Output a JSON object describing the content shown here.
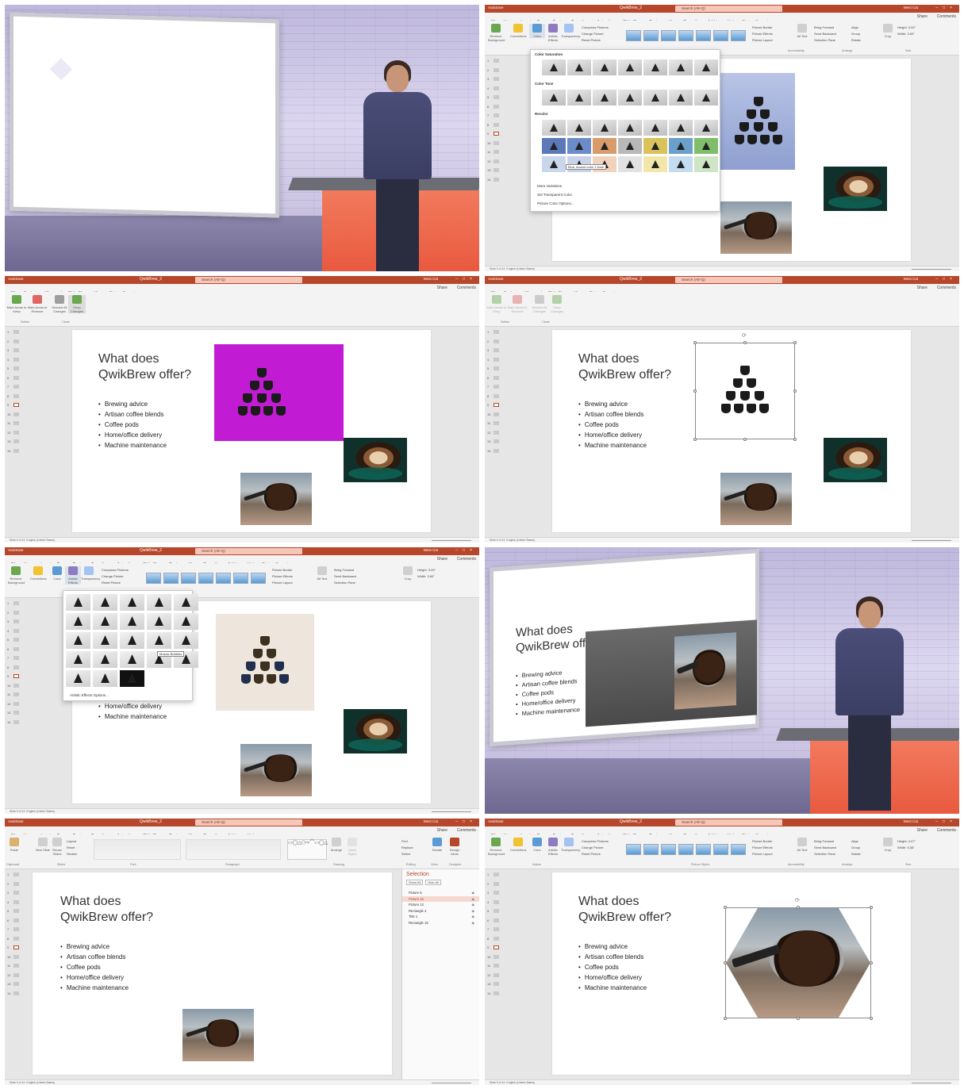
{
  "window": {
    "autosave": "AutoSave",
    "doc_title": "QwikBrew_2",
    "search_placeholder": "Search (Alt+Q)",
    "user_name": "West Cat",
    "share": "Share",
    "comments": "Comments"
  },
  "tabs_full": [
    "File",
    "Home",
    "Insert",
    "Draw",
    "Design",
    "Transitions",
    "Animations",
    "Slide Show",
    "Review",
    "View",
    "Recording",
    "Add-ins",
    "Help",
    "Picture Format"
  ],
  "tabs_bg_removal": [
    "File",
    "Background Removal",
    "Slide Show",
    "View",
    "Picture Format"
  ],
  "tabs_home": [
    "File",
    "Home",
    "Insert",
    "Draw",
    "Design",
    "Transitions",
    "Animations",
    "Slide Show",
    "Review",
    "View",
    "Recording",
    "Add-ins",
    "Help"
  ],
  "ribbon_picture_format": {
    "remove_background": "Remove Background",
    "corrections": "Corrections",
    "color": "Color",
    "artistic_effects": "Artistic Effects",
    "transparency": "Transparency",
    "compress": "Compress Pictures",
    "change": "Change Picture",
    "reset": "Reset Picture",
    "border": "Picture Border",
    "effects": "Picture Effects",
    "layout": "Picture Layout",
    "alt_text": "Alt Text",
    "bring_forward": "Bring Forward",
    "send_backward": "Send Backward",
    "selection_pane": "Selection Pane",
    "align": "Align",
    "group": "Group",
    "rotate": "Rotate",
    "crop": "Crop",
    "height_label": "Height:",
    "width_label": "Width:",
    "groups": [
      "Adjust",
      "Picture Styles",
      "Accessibility",
      "Arrange",
      "Size"
    ]
  },
  "ribbon_bg_removal": {
    "mark_keep": "Mark Areas to Keep",
    "mark_remove": "Mark Areas to Remove",
    "discard": "Discard All Changes",
    "keep": "Keep Changes",
    "groups": [
      "Refine",
      "Close"
    ]
  },
  "ribbon_home": {
    "paste": "Paste",
    "new_slide": "New Slide",
    "reuse_slides": "Reuse Slides",
    "layout": "Layout",
    "reset": "Reset",
    "section": "Section",
    "arrange": "Arrange",
    "quick_styles": "Quick Styles",
    "find": "Find",
    "replace": "Replace",
    "select": "Select",
    "dictate": "Dictate",
    "design_ideas": "Design Ideas",
    "groups": [
      "Clipboard",
      "Slides",
      "Font",
      "Paragraph",
      "Drawing",
      "Editing",
      "Voice",
      "Designer"
    ]
  },
  "color_menu": {
    "saturation": "Color Saturation",
    "tone": "Color Tone",
    "recolor": "Recolor",
    "tooltip": "Blue, Accent color 1 Dark",
    "more_variations": "More Variations",
    "set_transparent": "Set Transparent Color",
    "options": "Picture Color Options..."
  },
  "artistic_menu": {
    "tooltip": "Mosaic Bubbles",
    "options": "Artistic Effects Options..."
  },
  "slide": {
    "title_line1": "What does",
    "title_line2": "QwikBrew offer?",
    "bullets": [
      "Brewing advice",
      "Artisan coffee blends",
      "Coffee pods",
      "Home/office delivery",
      "Machine maintenance"
    ]
  },
  "selection_pane": {
    "title": "Selection",
    "show_all": "Show All",
    "hide_all": "Hide All",
    "items": [
      "Picture 6",
      "Picture 15",
      "Picture 13",
      "Rectangle 4",
      "Title 1",
      "Rectangle 15"
    ]
  },
  "status": {
    "slide_info": "Slide 9 of 14",
    "language": "English (United States)",
    "notes": "Notes",
    "display": "Display Settings",
    "zoom": "61%"
  },
  "size_values": {
    "height_p2": "3.00\"",
    "width_p2": "3.60\"",
    "height_p8": "4.07\"",
    "width_p8": "5.36\""
  },
  "colors": {
    "accent": "#b7472a",
    "studio_desk": "#e8573d",
    "magenta_removal": "#c21bd4"
  }
}
